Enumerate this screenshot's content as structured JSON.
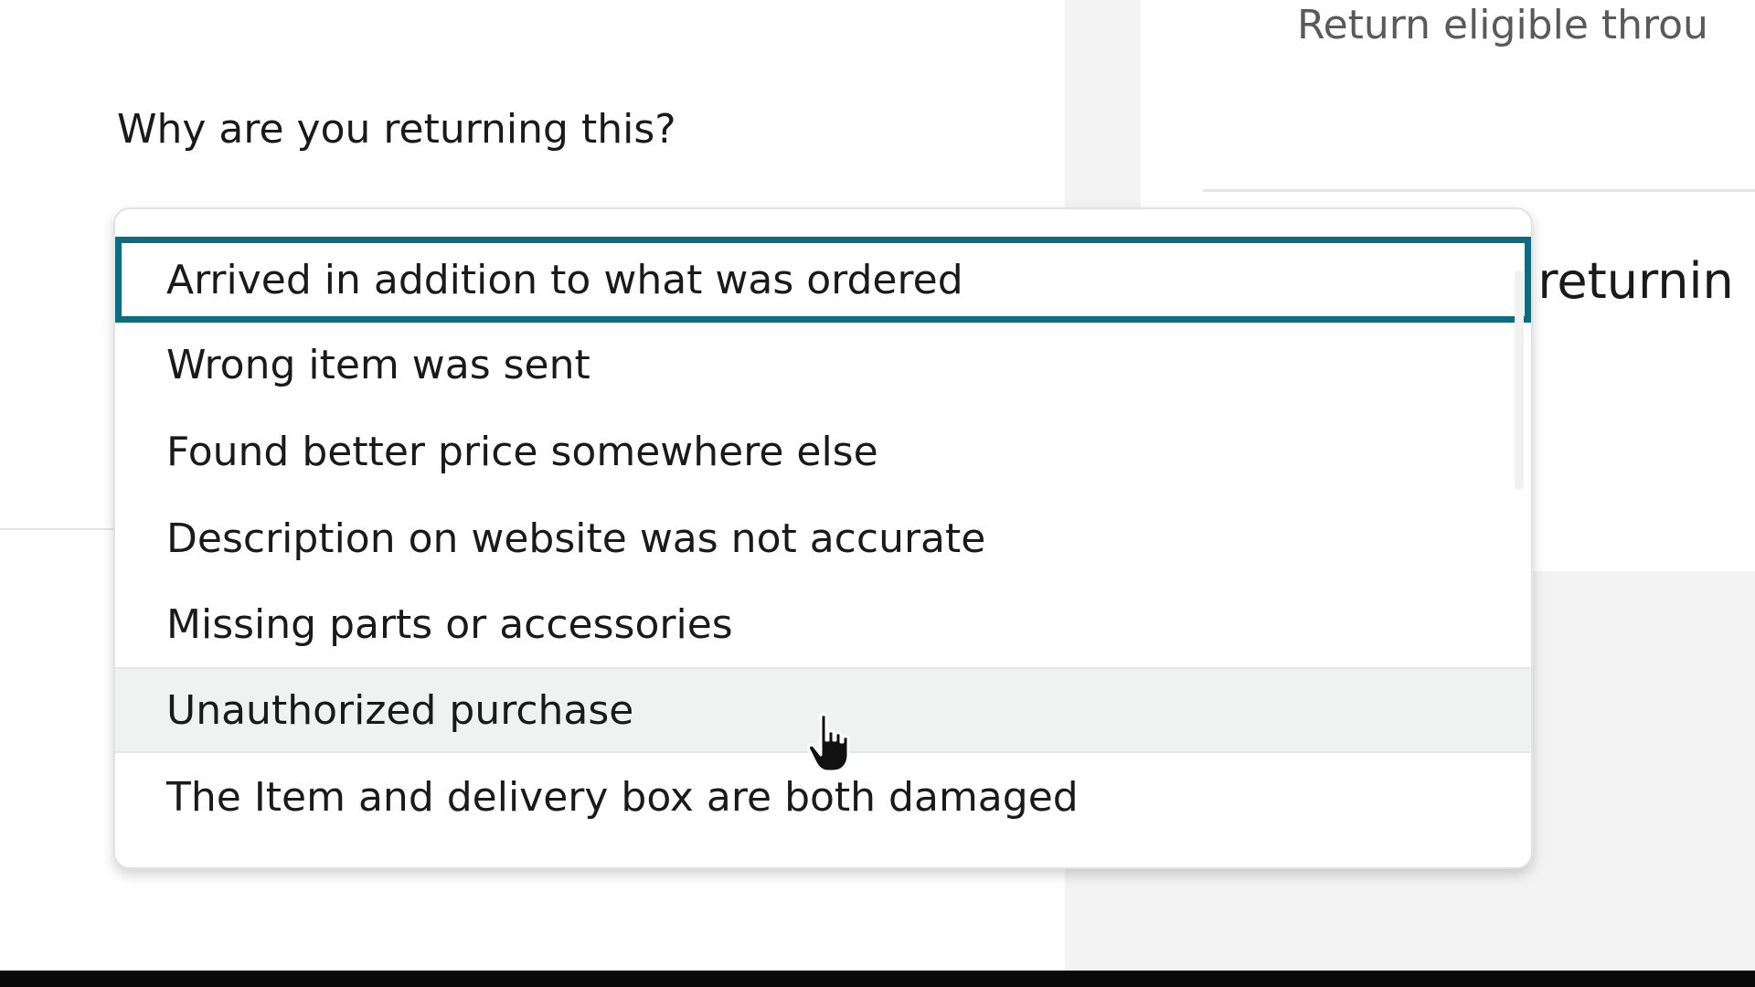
{
  "question": "Why are you returning this?",
  "right_panel": {
    "return_eligible_text": "Return eligible throu",
    "question_fragment": "e returnin"
  },
  "dropdown": {
    "selected_index": 0,
    "hover_index": 5,
    "options": [
      {
        "label": "Arrived in addition to what was ordered"
      },
      {
        "label": "Wrong item was sent"
      },
      {
        "label": "Found better price somewhere else"
      },
      {
        "label": "Description on website was not accurate"
      },
      {
        "label": "Missing parts or accessories"
      },
      {
        "label": "Unauthorized purchase"
      },
      {
        "label": "The Item and delivery box are both damaged"
      }
    ]
  },
  "colors": {
    "selected_border": "#0f6b7f",
    "hover_background": "#f0f2f2",
    "page_gutter": "#f3f3f3"
  },
  "cursor": {
    "icon": "hand-pointer-icon"
  }
}
